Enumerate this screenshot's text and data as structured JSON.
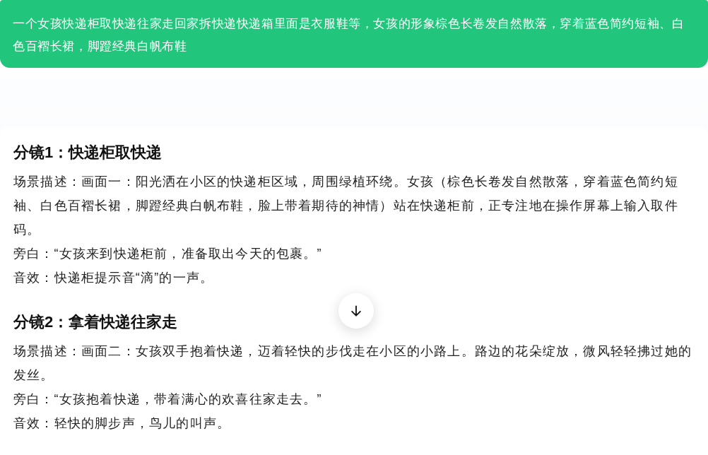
{
  "prompt_bubble": {
    "text": "一个女孩快递柜取快递往家走回家拆快递快递箱里面是衣服鞋等，女孩的形象棕色长卷发自然散落，穿着蓝色简约短袖、白色百褶长裙，脚蹬经典白帆布鞋"
  },
  "response": {
    "sections": [
      {
        "heading": "分镜1：快递柜取快递",
        "lines": [
          "场景描述：画面一：阳光洒在小区的快递柜区域，周围绿植环绕。女孩（棕色长卷发自然散落，穿着蓝色简约短袖、白色百褶长裙，脚蹬经典白帆布鞋，脸上带着期待的神情）站在快递柜前，正专注地在操作屏幕上输入取件码。",
          "旁白：“女孩来到快递柜前，准备取出今天的包裹。”",
          "音效：快递柜提示音“滴”的一声。"
        ]
      },
      {
        "heading": "分镜2：拿着快递往家走",
        "lines": [
          "场景描述：画面二：女孩双手抱着快递，迈着轻快的步伐走在小区的小路上。路边的花朵绽放，微风轻轻拂过她的发丝。",
          "旁白：“女孩抱着快递，带着满心的欢喜往家走去。”",
          "音效：轻快的脚步声，鸟儿的叫声。"
        ]
      }
    ]
  },
  "scroll_down_button": {
    "visible": true
  }
}
